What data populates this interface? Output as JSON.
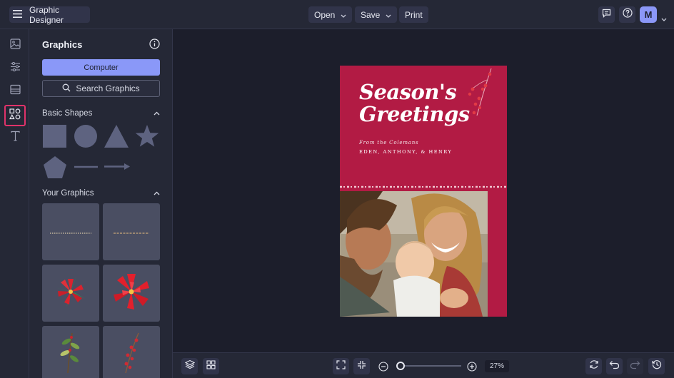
{
  "app": {
    "title": "Graphic Designer"
  },
  "toolbar": {
    "open_label": "Open",
    "save_label": "Save",
    "print_label": "Print",
    "avatar_initial": "M"
  },
  "panel": {
    "title": "Graphics",
    "computer_button": "Computer",
    "search_button": "Search Graphics",
    "basic_shapes_heading": "Basic Shapes",
    "your_graphics_heading": "Your Graphics"
  },
  "card": {
    "headline_line1": "Season's",
    "headline_line2": "Greetings",
    "from_line": "From the Colemans",
    "names_line": "EDEN, ANTHONY, & HENRY"
  },
  "zoom": {
    "label": "27%",
    "level_percent": 27
  },
  "colors": {
    "accent": "#8a98f8",
    "card_background": "#b21b44",
    "active_highlight": "#e0336a"
  }
}
